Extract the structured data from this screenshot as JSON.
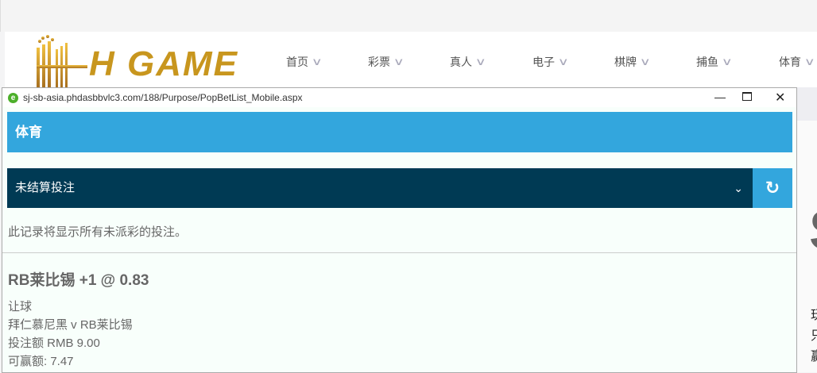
{
  "site": {
    "logo_text": "H GAME",
    "nav": [
      "首页",
      "彩票",
      "真人",
      "电子",
      "棋牌",
      "捕鱼",
      "体育"
    ]
  },
  "background": {
    "chars": [
      "玩",
      "只",
      "赢"
    ],
    "big_char": "S"
  },
  "popup": {
    "url": "sj-sb-asia.phdasbbvlc3.com/188/Purpose/PopBetList_Mobile.aspx",
    "header": "体育",
    "select_value": "未结算投注",
    "note": "此记录将显示所有未派彩的投注。",
    "bet": {
      "title": "RB莱比锡 +1 @ 0.83",
      "market": "让球",
      "match": "拜仁慕尼黑 v RB莱比锡",
      "stake": "投注额 RMB 9.00",
      "win": "可赢额: 7.47"
    }
  },
  "colors": {
    "accent": "#33a6dd",
    "dark": "#003a54"
  }
}
